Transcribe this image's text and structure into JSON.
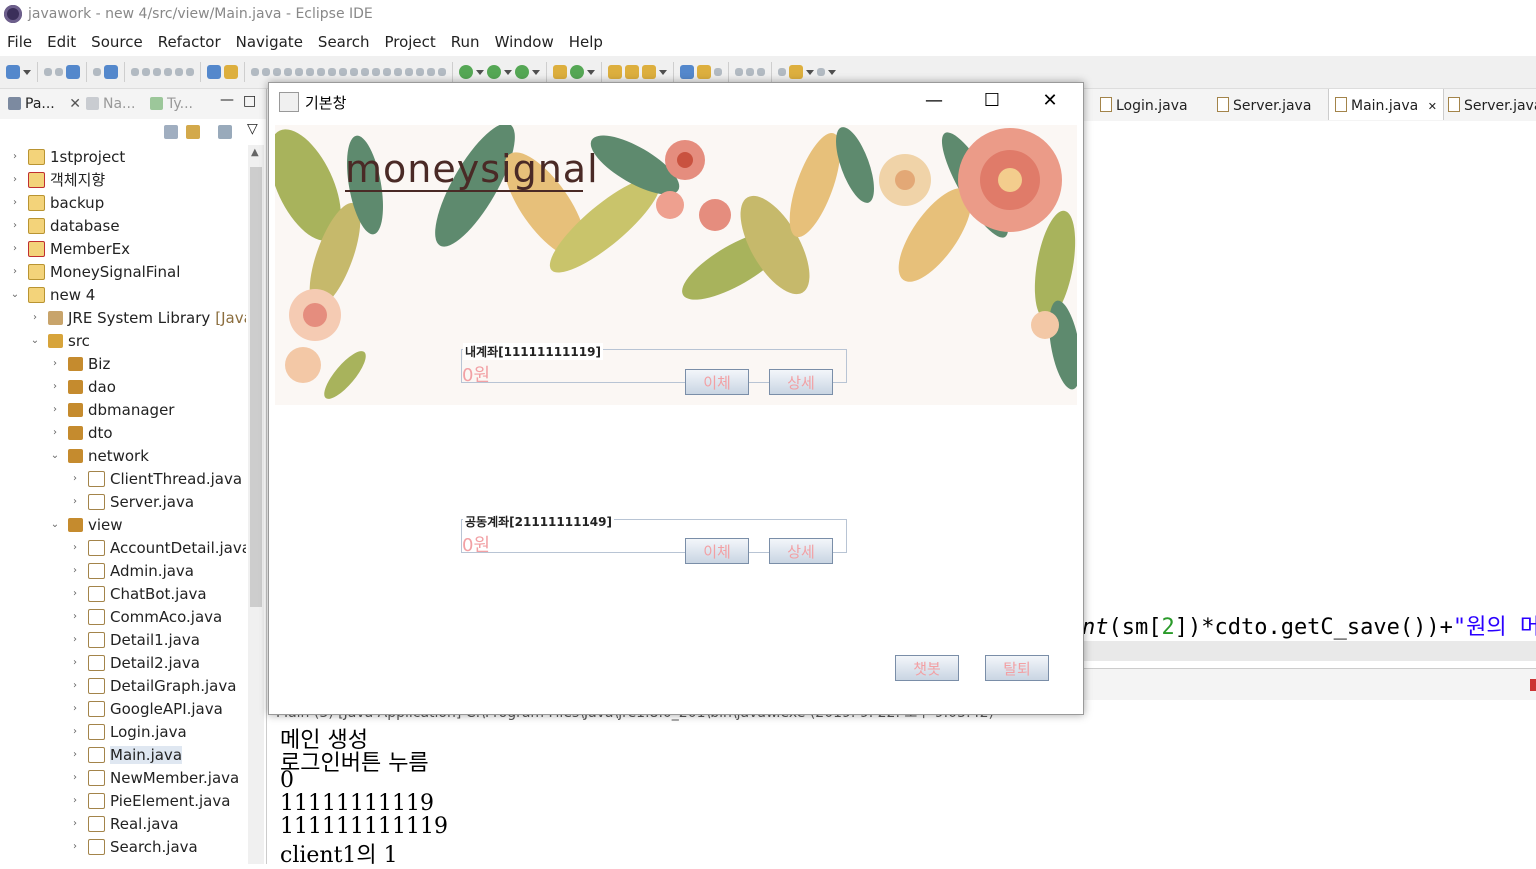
{
  "window": {
    "title": "javawork - new 4/src/view/Main.java - Eclipse IDE"
  },
  "menu": [
    "File",
    "Edit",
    "Source",
    "Refactor",
    "Navigate",
    "Search",
    "Project",
    "Run",
    "Window",
    "Help"
  ],
  "left_panel": {
    "tabs": [
      "Pa...",
      "Na...",
      "Ty..."
    ],
    "tree": [
      {
        "label": "1stproject",
        "icon": "project-icon",
        "depth": 0,
        "expanded": false
      },
      {
        "label": "객체지향",
        "icon": "project-error-icon",
        "depth": 0,
        "expanded": false
      },
      {
        "label": "backup",
        "icon": "project-icon",
        "depth": 0,
        "expanded": false
      },
      {
        "label": "database",
        "icon": "project-icon",
        "depth": 0,
        "expanded": false
      },
      {
        "label": "MemberEx",
        "icon": "project-error-icon",
        "depth": 0,
        "expanded": false
      },
      {
        "label": "MoneySignalFinal",
        "icon": "project-icon",
        "depth": 0,
        "expanded": false
      },
      {
        "label": "new 4",
        "icon": "project-icon",
        "depth": 0,
        "expanded": true
      },
      {
        "label": "JRE System Library",
        "deco": "[JavaSE",
        "icon": "library-icon",
        "depth": 1,
        "expanded": false
      },
      {
        "label": "src",
        "icon": "source-folder-icon",
        "depth": 1,
        "expanded": true
      },
      {
        "label": "Biz",
        "icon": "package-icon",
        "depth": 2,
        "expanded": false
      },
      {
        "label": "dao",
        "icon": "package-icon",
        "depth": 2,
        "expanded": false
      },
      {
        "label": "dbmanager",
        "icon": "package-icon",
        "depth": 2,
        "expanded": false
      },
      {
        "label": "dto",
        "icon": "package-icon",
        "depth": 2,
        "expanded": false
      },
      {
        "label": "network",
        "icon": "package-icon",
        "depth": 2,
        "expanded": true
      },
      {
        "label": "ClientThread.java",
        "icon": "java-file-icon",
        "depth": 3,
        "expanded": false
      },
      {
        "label": "Server.java",
        "icon": "java-file-icon",
        "depth": 3,
        "expanded": false
      },
      {
        "label": "view",
        "icon": "package-icon",
        "depth": 2,
        "expanded": true
      },
      {
        "label": "AccountDetail.java",
        "icon": "java-file-icon",
        "depth": 3,
        "expanded": false
      },
      {
        "label": "Admin.java",
        "icon": "java-file-icon",
        "depth": 3,
        "expanded": false
      },
      {
        "label": "ChatBot.java",
        "icon": "java-file-icon",
        "depth": 3,
        "expanded": false
      },
      {
        "label": "CommAco.java",
        "icon": "java-file-icon",
        "depth": 3,
        "expanded": false
      },
      {
        "label": "Detail1.java",
        "icon": "java-file-icon",
        "depth": 3,
        "expanded": false
      },
      {
        "label": "Detail2.java",
        "icon": "java-file-icon",
        "depth": 3,
        "expanded": false
      },
      {
        "label": "DetailGraph.java",
        "icon": "java-file-icon",
        "depth": 3,
        "expanded": false
      },
      {
        "label": "GoogleAPI.java",
        "icon": "java-file-icon",
        "depth": 3,
        "expanded": false
      },
      {
        "label": "Login.java",
        "icon": "java-file-icon",
        "depth": 3,
        "expanded": false
      },
      {
        "label": "Main.java",
        "icon": "java-file-icon",
        "depth": 3,
        "expanded": false,
        "selected": true
      },
      {
        "label": "NewMember.java",
        "icon": "java-file-icon",
        "depth": 3,
        "expanded": false
      },
      {
        "label": "PieElement.java",
        "icon": "java-file-icon",
        "depth": 3,
        "expanded": false
      },
      {
        "label": "Real.java",
        "icon": "java-file-icon",
        "depth": 3,
        "expanded": false
      },
      {
        "label": "Search.java",
        "icon": "java-file-icon",
        "depth": 3,
        "expanded": false
      }
    ]
  },
  "editor": {
    "tabs": [
      {
        "label": "Login.java",
        "active": false
      },
      {
        "label": "Server.java",
        "active": false
      },
      {
        "label": "Main.java",
        "active": true
      },
      {
        "label": "Server.java",
        "active": false
      }
    ],
    "code_line": {
      "pre": "nt",
      "mid1": "(sm[",
      "num": "2",
      "mid2": "])*cdto.getC_save())+",
      "str": "\"원의 머"
    }
  },
  "console": {
    "header": "Main (3) [Java Application] C:\\Program Files\\Java\\jre1.8.0_201\\bin\\javaw.exe (2019. 9. 22. 오후 9:05:42)",
    "lines": [
      "메인 생성",
      "로그인버튼 누름",
      "0",
      "11111111119",
      "111111111119",
      "client1의 1"
    ]
  },
  "dialog": {
    "title": "기본창",
    "brand": "moneysignal",
    "accounts": [
      {
        "title": "내계좌[11111111119]",
        "amount": "0원",
        "transfer": "이체",
        "detail": "상세"
      },
      {
        "title": "공동계좌[21111111149]",
        "amount": "0원",
        "transfer": "이체",
        "detail": "상세"
      }
    ],
    "chatbot": "챗봇",
    "withdraw": "탈퇴"
  },
  "colors": {
    "accent_pink": "#f2a0a4",
    "brand_brown": "#4a2a26",
    "button_border": "#7a8ea8"
  }
}
